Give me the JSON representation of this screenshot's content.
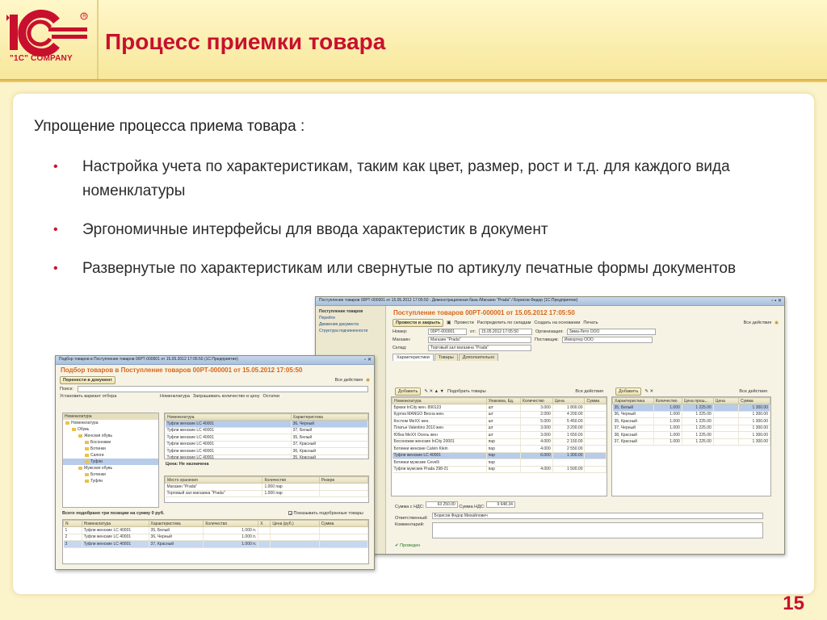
{
  "slide": {
    "logo_text": "\"1C\" COMPANY",
    "title": "Процесс приемки товара",
    "intro": "Упрощение процесса приема товара :",
    "bullets": [
      "Настройка учета по характеристикам, таким как цвет, размер, рост и т.д. для каждого вида номенклатуры",
      "Эргономичные интерфейсы для ввода характеристик в документ",
      "Развернутые по характеристикам или свернутые по артикулу печатные формы документов"
    ],
    "page_number": "15",
    "colors": {
      "accent": "#c8102e",
      "header": "#f7e79a",
      "doc_heading": "#d6661b"
    }
  },
  "receipt_window": {
    "title": "Поступление товаров 00РТ-000001 от 15.05.2012 17:05:50 : Демонстрационная база /Магазин \"Prada\" / Борисов Федор   (1С:Предприятие)",
    "nav": {
      "header": "Поступление товаров",
      "items": [
        "Перейти",
        "Движения документа",
        "Структура подчиненности"
      ]
    },
    "heading": "Поступление товаров 00РТ-000001 от 15.05.2012 17:05:50",
    "toolbar": {
      "post_close": "Провести и закрыть",
      "post": "Провести",
      "by_warehouse": "Распределить по складам",
      "create_based": "Создать на основании",
      "print": "Печать",
      "all_actions": "Все действия"
    },
    "fields": {
      "number_label": "Номер:",
      "number": "00РТ-000001",
      "date_label": "от:",
      "date": "15.05.2012 17:05:50",
      "org_label": "Организация:",
      "org": "Зима-Лето ООО",
      "store_label": "Магазин:",
      "store": "Магазин \"Prada\"",
      "supplier_label": "Поставщик:",
      "supplier": "Импортер ООО",
      "warehouse_label": "Склад:",
      "warehouse": "Торговый зал магазина \"Prada\""
    },
    "tabs": [
      "Характеристики",
      "Товары",
      "Дополнительно"
    ],
    "goods_toolbar": {
      "add": "Добавить",
      "pick": "Подобрать товары",
      "all_actions": "Все действия"
    },
    "goods_columns": [
      "Номенклатура",
      "Упаковка, Ед.",
      "Количество",
      "Цена",
      "Сумма"
    ],
    "goods_rows": [
      [
        "Брюки InCity жен. 890123",
        "шт",
        "3.000",
        "1 800.00",
        ""
      ],
      [
        "Куртка MANGO Весна жен.",
        "шт",
        "2.000",
        "4 200.00",
        ""
      ],
      [
        "Костюм MeXX жен.",
        "шт",
        "5.000",
        "5 450.00",
        ""
      ],
      [
        "Платье Valentino 2010 жен",
        "шт",
        "3.000",
        "3 200.00",
        ""
      ],
      [
        "Юбка MeXX Осень жен",
        "шт",
        "3.000",
        "1 650.00",
        ""
      ],
      [
        "Босоножки женские InCity 20001",
        "пар",
        "4.000",
        "2 150.00",
        ""
      ],
      [
        "Ботинки женские Calvin Klein",
        "пар",
        "4.000",
        "2 550.00",
        ""
      ],
      [
        "Туфли женские LC 40001",
        "пар",
        "6.000",
        "1 300.00",
        ""
      ],
      [
        "Ботинки мужские Cevelli",
        "пар",
        "",
        "",
        ""
      ],
      [
        "Туфли мужские Prada 298-21",
        "пар",
        "4.000",
        "1 500.00",
        ""
      ]
    ],
    "char_toolbar": {
      "add": "Добавить",
      "all_actions": "Все действия"
    },
    "char_columns": [
      "Характеристика",
      "Количество",
      "Цена прош...",
      "Цена",
      "Сумма"
    ],
    "char_rows": [
      [
        "35, Белый",
        "1.000",
        "1 225.00",
        "",
        "1 300.00"
      ],
      [
        "36, Черный",
        "1.000",
        "1 225.00",
        "",
        "1 300.00"
      ],
      [
        "35, Красный",
        "1.000",
        "1 225.00",
        "",
        "1 300.00"
      ],
      [
        "37, Черный",
        "1.000",
        "1 225.00",
        "",
        "1 300.00"
      ],
      [
        "38, Красный",
        "1.000",
        "1 225.00",
        "",
        "1 300.00"
      ],
      [
        "37, Красный",
        "1.000",
        "1 225.00",
        "",
        "1 300.00"
      ]
    ],
    "totals": {
      "sum_label": "Сумма с НДС:",
      "sum": "63 250.00",
      "vat_label": "Сумма НДС:",
      "vat": "9 648.34"
    },
    "responsible_label": "Ответственный:",
    "responsible": "Борисов Федор Михайлович",
    "comment_label": "Комментарий:",
    "posted": "Проведен"
  },
  "pick_window": {
    "title": "Подбор товаров в Поступление товаров 00РТ-000001 от 15.05.2012 17:05:50  (1С:Предприятие)",
    "heading": "Подбор товаров в Поступление товаров 00РТ-000001 от 15.05.2012 17:05:50",
    "toolbar": {
      "transfer": "Перенести в документ",
      "all_actions": "Все действия"
    },
    "search_label": "Поиск:",
    "left_toolbar": "Установить вариант отбора",
    "right_toolbar": {
      "nomenclature": "Номенклатура",
      "request": "Запрашивать количество и цену",
      "stock": "Остатки"
    },
    "tree_header": "Номенклатура",
    "tree": [
      "Номенклатура",
      "Обувь",
      "Женская обувь",
      "Босоножки",
      "Ботинки",
      "Сапоги",
      "Туфли",
      "Мужская обувь",
      "Ботинки",
      "Туфли"
    ],
    "items_columns": [
      "Номенклатура",
      "Характеристика"
    ],
    "items_rows": [
      [
        "Туфли женские LC 40001",
        "36, Черный"
      ],
      [
        "Туфли женские LC 40001",
        "37, Белый"
      ],
      [
        "Туфли женские LC 40001",
        "35, Белый"
      ],
      [
        "Туфли женские LC 40001",
        "37, Красный"
      ],
      [
        "Туфли женские LC 40001",
        "36, Красный"
      ],
      [
        "Туфли женские LC 40001",
        "35, Красный"
      ]
    ],
    "price_line": "Цена: Не назначена",
    "stock_columns": [
      "Место хранения",
      "Количество",
      "Резерв"
    ],
    "stock_rows": [
      [
        "Магазин \"Prada\"",
        "1.000 пар",
        ""
      ],
      [
        "Торговый зал магазина \"Prada\"",
        "1.000 пар",
        ""
      ]
    ],
    "summary": "Всего подобрано три позиции на сумму 0 руб.",
    "show_picked": "Показывать подобранные товары",
    "picked_columns": [
      "N",
      "Номенклатура",
      "Характеристика",
      "Количество",
      "Х",
      "Цена (руб.)",
      "Сумма"
    ],
    "picked_rows": [
      [
        "1",
        "Туфли женские LC 40001",
        "35, Белый",
        "1.000 п.",
        "",
        "",
        ""
      ],
      [
        "2",
        "Туфли женские LC 40001",
        "36, Черный",
        "1.000 п.",
        "",
        "",
        ""
      ],
      [
        "3",
        "Туфли женские LC 40001",
        "37, Красный",
        "1.000 п.",
        "",
        "",
        ""
      ]
    ]
  }
}
